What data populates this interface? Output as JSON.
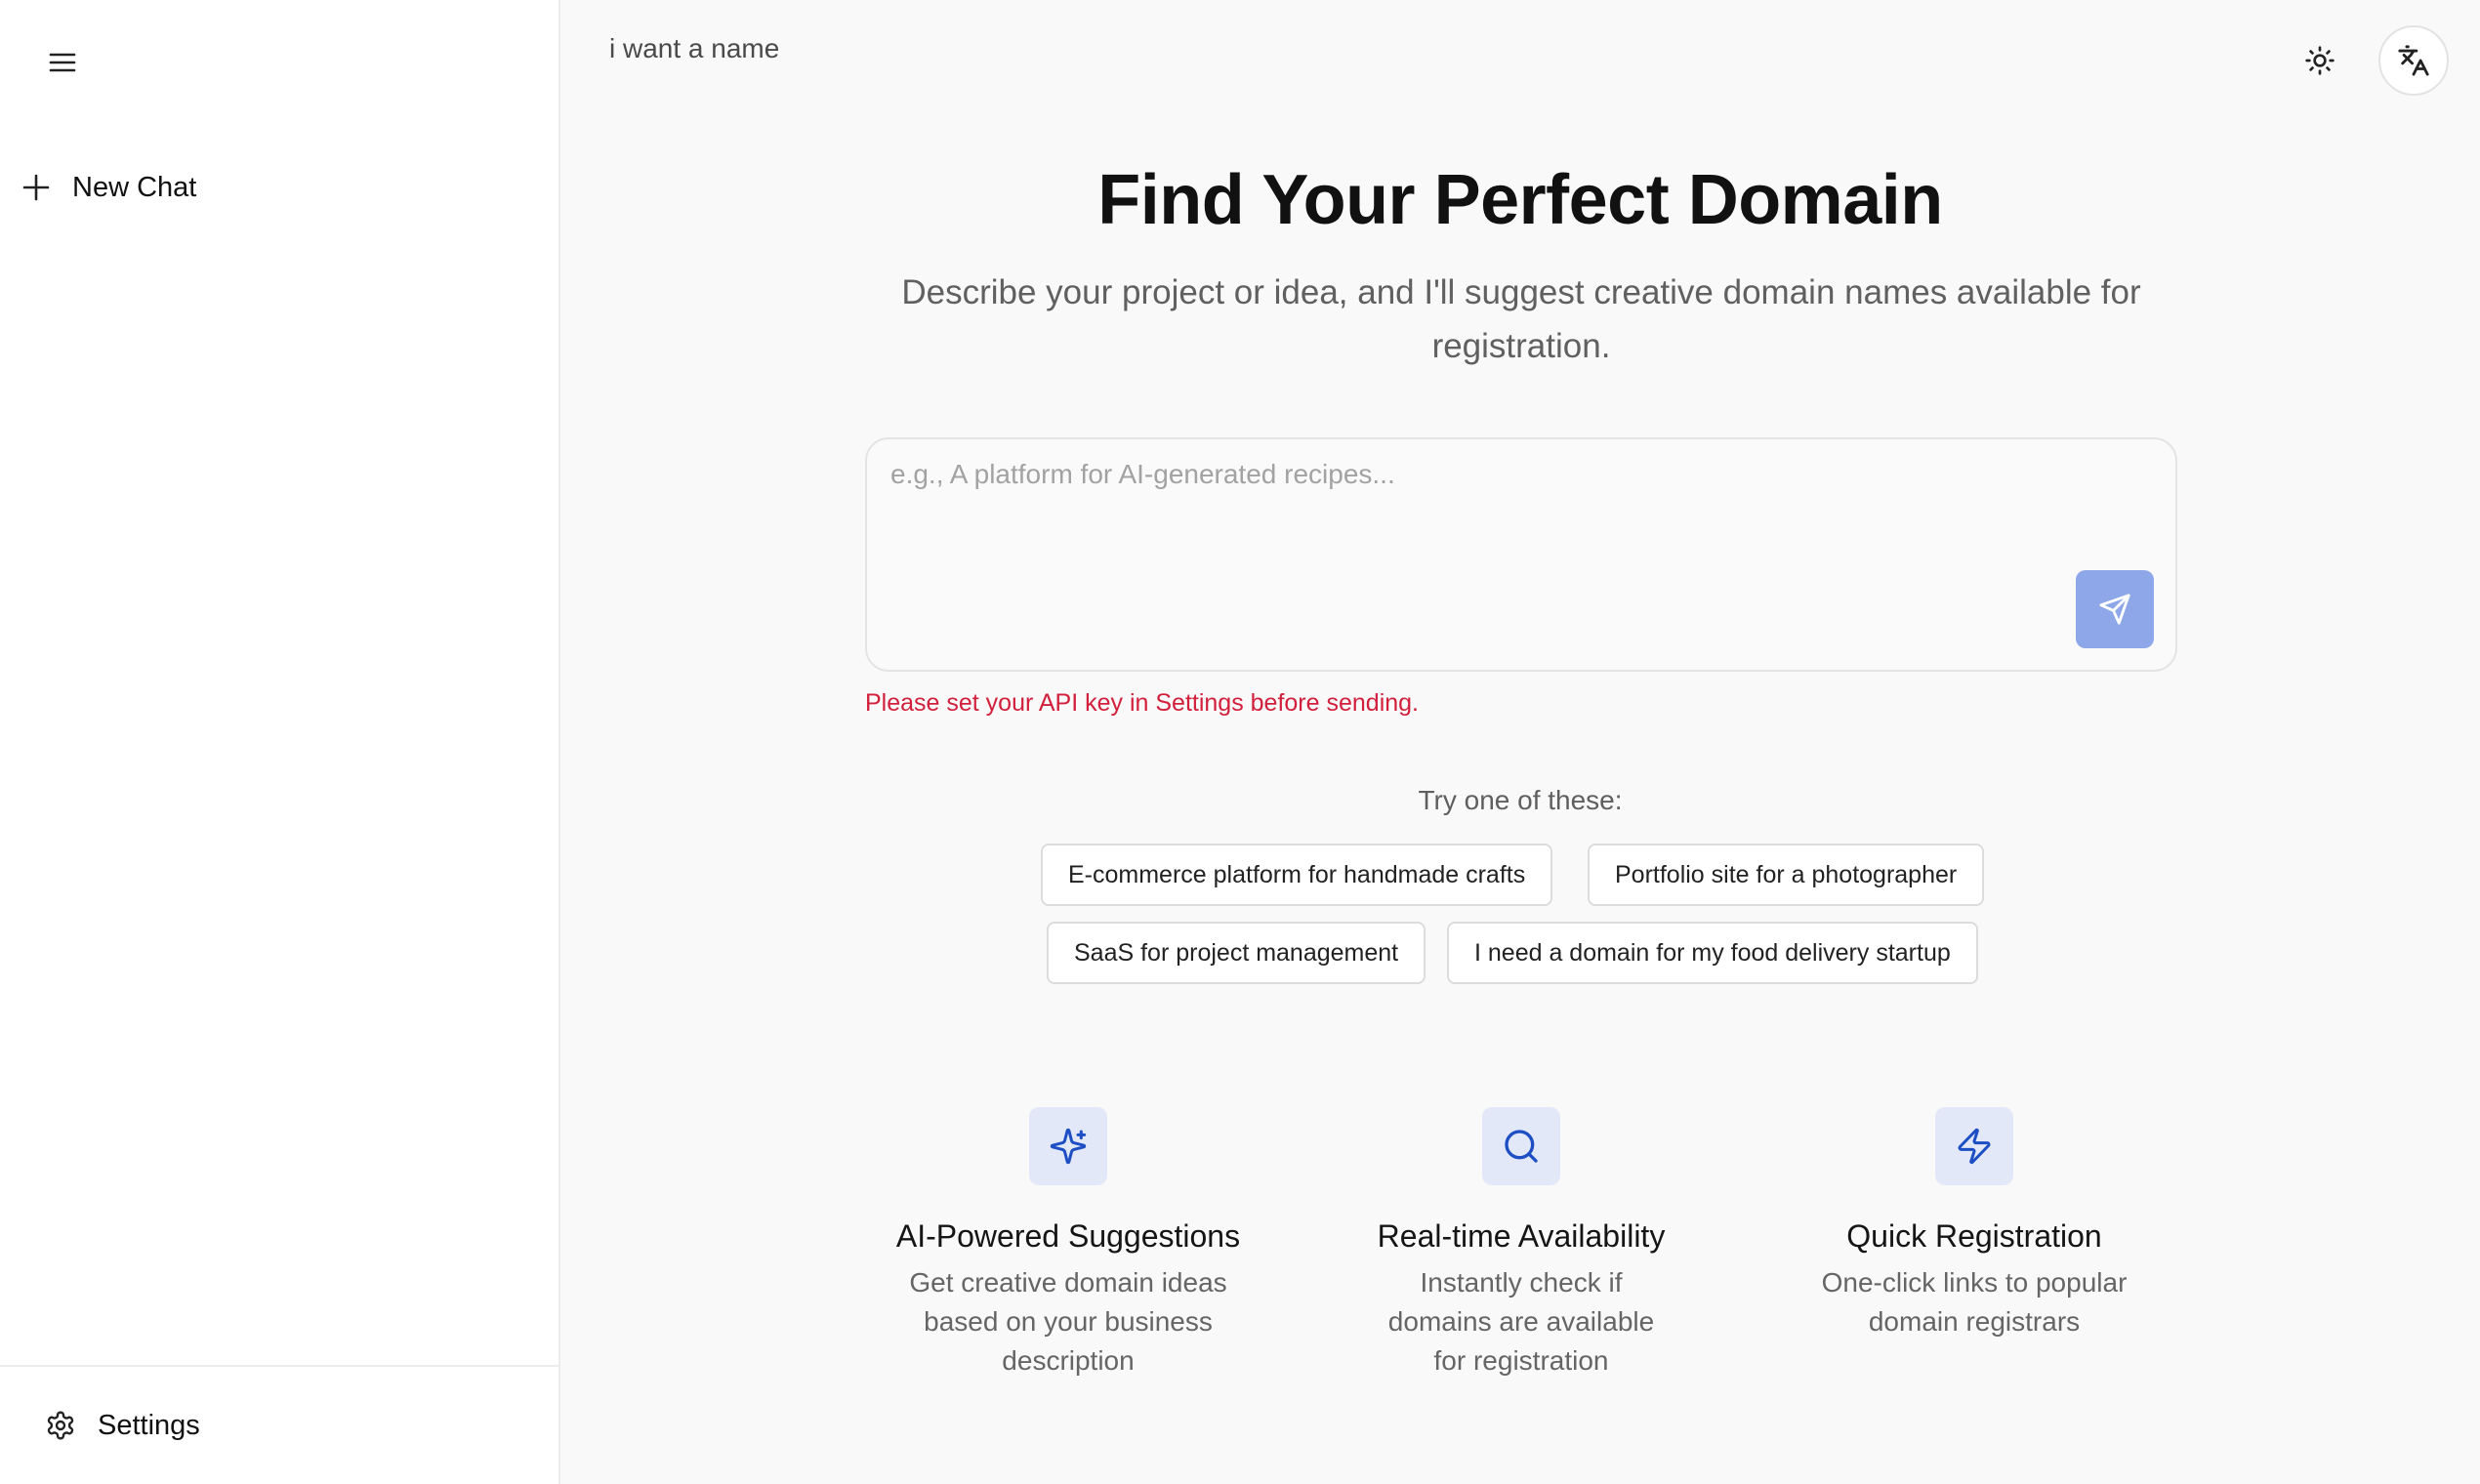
{
  "sidebar": {
    "new_chat_label": "New Chat",
    "settings_label": "Settings"
  },
  "topbar": {
    "chat_title": "i want a name"
  },
  "hero": {
    "title": "Find Your Perfect Domain",
    "subtitle": "Describe your project or idea, and I'll suggest creative domain names available for registration."
  },
  "prompt": {
    "placeholder": "e.g., A platform for AI-generated recipes...",
    "value": "",
    "error": "Please set your API key in Settings before sending."
  },
  "suggestions": {
    "label": "Try one of these:",
    "items": [
      "E-commerce platform for handmade crafts",
      "Portfolio site for a photographer",
      "SaaS for project management",
      "I need a domain for my food delivery startup"
    ]
  },
  "features": [
    {
      "icon": "sparkles-icon",
      "title": "AI-Powered Suggestions",
      "desc": "Get creative domain ideas based on your business description"
    },
    {
      "icon": "search-icon",
      "title": "Real-time Availability",
      "desc": "Instantly check if domains are available for registration"
    },
    {
      "icon": "lightning-icon",
      "title": "Quick Registration",
      "desc": "One-click links to popular domain registrars"
    }
  ],
  "colors": {
    "accent": "#1d4ec4",
    "send_button": "#8da7e8",
    "error": "#d21f3c",
    "feature_icon_bg": "#e3e8f8"
  }
}
